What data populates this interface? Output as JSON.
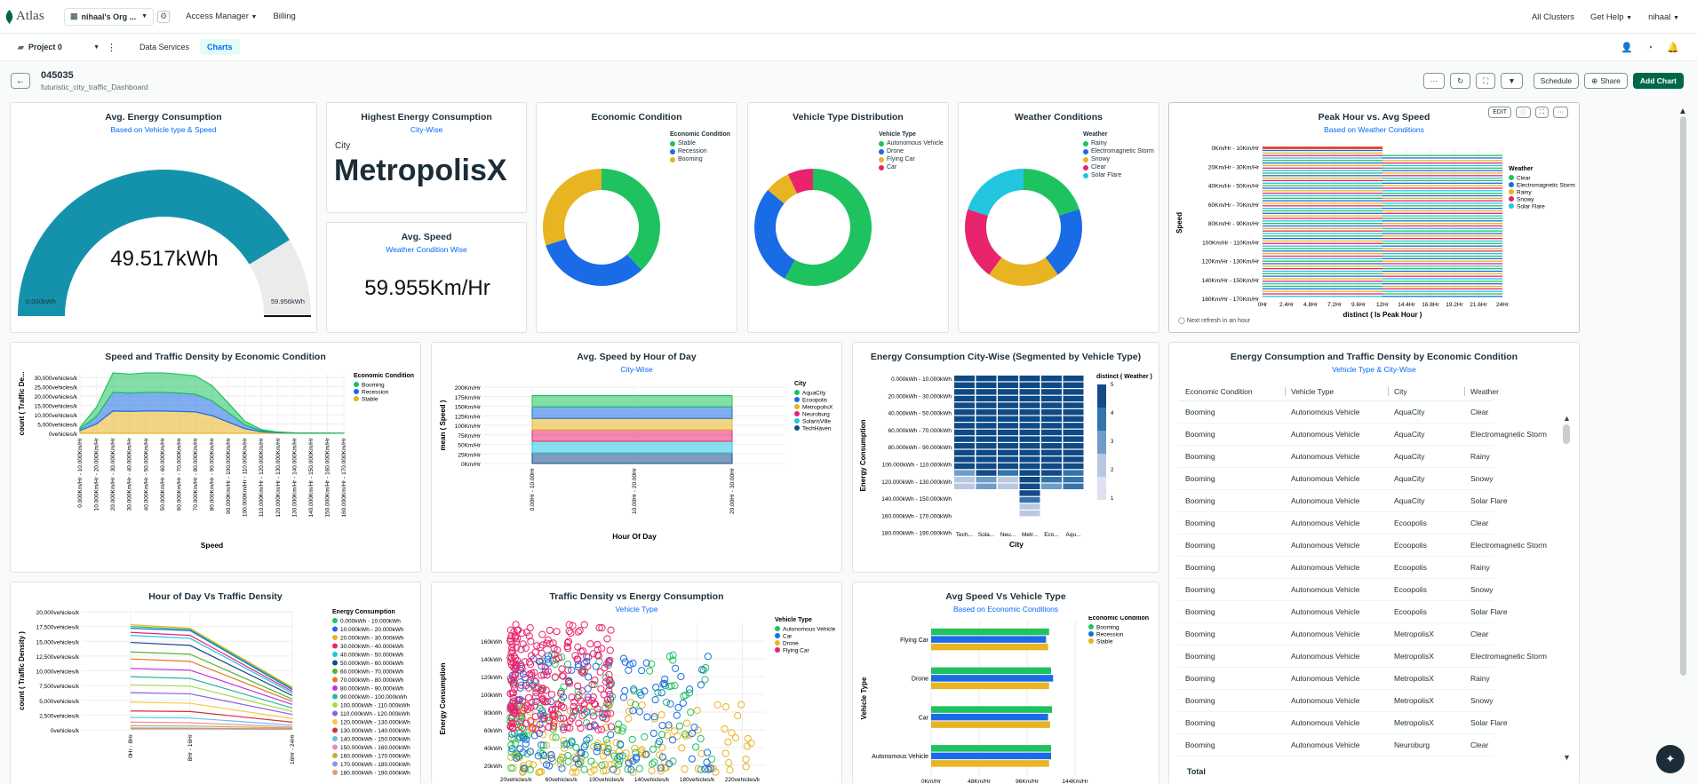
{
  "topbar": {
    "logo": "Atlas",
    "org": "nihaal's Org ...",
    "access": "Access Manager",
    "billing": "Billing",
    "all_clusters": "All Clusters",
    "get_help": "Get Help",
    "user": "nihaal"
  },
  "subbar": {
    "project": "Project 0",
    "tabs": [
      "Data Services",
      "Charts"
    ]
  },
  "dashboard": {
    "title": "045035",
    "subtitle": "futuristic_city_traffic_Dashboard",
    "schedule": "Schedule",
    "share": "Share",
    "add_chart": "Add Chart"
  },
  "colors": {
    "teal": "#1592ab",
    "green": "#1ec35f",
    "blue": "#1a6be6",
    "gold": "#e8b422",
    "pink": "#e8246d",
    "red": "#db3030",
    "cyan": "#22c6e0",
    "navy": "#164a87"
  },
  "cards": {
    "gauge": {
      "title": "Avg. Energy Consumption",
      "subtitle": "Based on Vehicle type & Speed",
      "value": "49.517kWh",
      "min": "0.000kWh",
      "max": "59.956kWh",
      "fraction": 0.826
    },
    "highest": {
      "title": "Highest Energy Consumption",
      "subtitle": "City-Wise",
      "label": "City",
      "value": "MetropolisX"
    },
    "avgspeed": {
      "title": "Avg. Speed",
      "subtitle": "Weather Condition Wise",
      "value": "59.955Km/Hr"
    },
    "economic": {
      "title": "Economic Condition",
      "legend_title": "Economic Condition"
    },
    "vehicle": {
      "title": "Vehicle Type Distribution",
      "legend_title": "Vehicle Type"
    },
    "weather": {
      "title": "Weather Conditions",
      "legend_title": "Weather"
    },
    "peak": {
      "title": "Peak Hour vs. Avg Speed",
      "subtitle": "Based on Weather Conditions",
      "xlabel": "distinct ( Is Peak Hour )",
      "ylabel": "Speed",
      "legend_title": "Weather",
      "edit": "EDIT",
      "refresh": "Next refresh in an hour"
    },
    "speedtraffic": {
      "title": "Speed and Traffic Density by Economic Condition",
      "xlabel": "Speed",
      "ylabel": "count ( Traffic De...",
      "legend_title": "Economic Condition"
    },
    "avgspeedhour": {
      "title": "Avg. Speed by Hour of Day",
      "subtitle": "City-Wise",
      "xlabel": "Hour Of Day",
      "ylabel": "mean ( Speed )",
      "legend_title": "City"
    },
    "energycity": {
      "title": "Energy Consumption City-Wise (Segmented by Vehicle Type)",
      "xlabel": "City",
      "ylabel": "Energy Consumption",
      "legend_title": "distinct ( Weather )"
    },
    "table": {
      "title": "Energy Consumption and Traffic Density by Economic Condition",
      "subtitle": "Vehicle Type & City-Wise",
      "headers": [
        "Economic Condition",
        "Vehicle Type",
        "City",
        "Weather"
      ],
      "total": "Total",
      "rows": [
        [
          "Booming",
          "Autonomous Vehicle",
          "AquaCity",
          "Clear"
        ],
        [
          "Booming",
          "Autonomous Vehicle",
          "AquaCity",
          "Electromagnetic Storm"
        ],
        [
          "Booming",
          "Autonomous Vehicle",
          "AquaCity",
          "Rainy"
        ],
        [
          "Booming",
          "Autonomous Vehicle",
          "AquaCity",
          "Snowy"
        ],
        [
          "Booming",
          "Autonomous Vehicle",
          "AquaCity",
          "Solar Flare"
        ],
        [
          "Booming",
          "Autonomous Vehicle",
          "Ecoopolis",
          "Clear"
        ],
        [
          "Booming",
          "Autonomous Vehicle",
          "Ecoopolis",
          "Electromagnetic Storm"
        ],
        [
          "Booming",
          "Autonomous Vehicle",
          "Ecoopolis",
          "Rainy"
        ],
        [
          "Booming",
          "Autonomous Vehicle",
          "Ecoopolis",
          "Snowy"
        ],
        [
          "Booming",
          "Autonomous Vehicle",
          "Ecoopolis",
          "Solar Flare"
        ],
        [
          "Booming",
          "Autonomous Vehicle",
          "MetropolisX",
          "Clear"
        ],
        [
          "Booming",
          "Autonomous Vehicle",
          "MetropolisX",
          "Electromagnetic Storm"
        ],
        [
          "Booming",
          "Autonomous Vehicle",
          "MetropolisX",
          "Rainy"
        ],
        [
          "Booming",
          "Autonomous Vehicle",
          "MetropolisX",
          "Snowy"
        ],
        [
          "Booming",
          "Autonomous Vehicle",
          "MetropolisX",
          "Solar Flare"
        ],
        [
          "Booming",
          "Autonomous Vehicle",
          "Neuroburg",
          "Clear"
        ]
      ]
    },
    "hourtraffic": {
      "title": "Hour of Day Vs Traffic Density",
      "ylabel": "count ( Traffic Density )",
      "legend_title": "Energy Consumption"
    },
    "scatter": {
      "title": "Traffic Density vs Energy Consumption",
      "subtitle": "Vehicle Type",
      "ylabel": "Energy Consumption",
      "legend_title": "Vehicle Type"
    },
    "avgvehicle": {
      "title": "Avg Speed Vs Vehicle Type",
      "subtitle": "Based on Economic Conditions",
      "ylabel": "Vehicle Type",
      "legend_title": "Economic Condition"
    }
  },
  "chart_data": [
    {
      "type": "pie",
      "title": "Economic Condition",
      "legend": [
        "Stable",
        "Recession",
        "Booming"
      ],
      "values": [
        38,
        32,
        30
      ],
      "colors": [
        "#1ec35f",
        "#1a6be6",
        "#e8b422"
      ]
    },
    {
      "type": "pie",
      "title": "Vehicle Type Distribution",
      "legend": [
        "Autonomous Vehicle",
        "Drone",
        "Flying Car",
        "Car"
      ],
      "values": [
        58,
        28,
        7,
        7
      ],
      "colors": [
        "#1ec35f",
        "#1a6be6",
        "#e8b422",
        "#e8246d"
      ]
    },
    {
      "type": "pie",
      "title": "Weather Conditions",
      "legend": [
        "Rainy",
        "Electromagnetic Storm",
        "Snowy",
        "Clear",
        "Solar Flare"
      ],
      "values": [
        20,
        20,
        20,
        20,
        20
      ],
      "colors": [
        "#1ec35f",
        "#1a6be6",
        "#e8b422",
        "#e8246d",
        "#22c6e0"
      ]
    },
    {
      "type": "bar",
      "title": "Peak Hour vs. Avg Speed",
      "y_categories": [
        "0Km/Hr - 10Km/Hr",
        "20Km/Hr - 30Km/Hr",
        "40Km/Hr - 50Km/Hr",
        "60Km/Hr - 70Km/Hr",
        "80Km/Hr - 90Km/Hr",
        "100Km/Hr - 110Km/Hr",
        "120Km/Hr - 130Km/Hr",
        "140Km/Hr - 150Km/Hr",
        "160Km/Hr - 170Km/Hr"
      ],
      "x_ticks": [
        "0Hr",
        "2.4Hr",
        "4.8Hr",
        "7.2Hr",
        "9.6Hr",
        "12Hr",
        "14.4Hr",
        "16.8Hr",
        "19.2Hr",
        "21.6Hr",
        "24Hr"
      ],
      "legend": [
        "Clear",
        "Electromagnetic Storm",
        "Rainy",
        "Snowy",
        "Solar Flare"
      ],
      "colors": [
        "#1ec35f",
        "#1a6be6",
        "#e8b422",
        "#e8246d",
        "#22c6e0"
      ],
      "xlim": [
        0,
        24
      ]
    },
    {
      "type": "area",
      "title": "Speed and Traffic Density by Economic Condition",
      "categories": [
        "0.000Km/Hr - 10.000Km/Hr",
        "10.000Km/Hr - 20.000Km/Hr",
        "20.000Km/Hr - 30.000Km/Hr",
        "30.000Km/Hr - 40.000Km/Hr",
        "40.000Km/Hr - 50.000Km/Hr",
        "50.000Km/Hr - 60.000Km/Hr",
        "60.000Km/Hr - 70.000Km/Hr",
        "70.000Km/Hr - 80.000Km/Hr",
        "80.000Km/Hr - 90.000Km/Hr",
        "90.000Km/Hr - 100.000Km/Hr",
        "100.000Km/Hr - 110.000Km/Hr",
        "110.000Km/Hr - 120.000Km/Hr",
        "120.000Km/Hr - 130.000Km/Hr",
        "130.000Km/Hr - 140.000Km/Hr",
        "140.000Km/Hr - 150.000Km/Hr",
        "150.000Km/Hr - 160.000Km/Hr",
        "160.000Km/Hr - 170.000Km/Hr"
      ],
      "y_ticks": [
        "0vehicles/k",
        "5,000vehicles/k",
        "10,000vehicles/k",
        "15,000vehicles/k",
        "20,000vehicles/k",
        "25,000vehicles/k",
        "30,000vehicles/k"
      ],
      "ylim": [
        0,
        32000
      ],
      "series": [
        {
          "name": "Stable",
          "color": "#e8b422",
          "values": [
            1500,
            5000,
            12000,
            11800,
            12000,
            12000,
            11800,
            11500,
            9500,
            6000,
            2500,
            800,
            300,
            100,
            50,
            30,
            20
          ]
        },
        {
          "name": "Recession",
          "color": "#1a6be6",
          "values": [
            800,
            4000,
            10000,
            9800,
            10000,
            10000,
            9800,
            9500,
            8000,
            5000,
            2000,
            600,
            200,
            80,
            40,
            20,
            10
          ]
        },
        {
          "name": "Booming",
          "color": "#1ec35f",
          "values": [
            800,
            5000,
            10500,
            10200,
            10500,
            10500,
            10200,
            9900,
            8200,
            5200,
            2000,
            600,
            200,
            80,
            40,
            20,
            10
          ]
        }
      ]
    },
    {
      "type": "area",
      "title": "Avg. Speed by Hour of Day",
      "categories": [
        "0.00Hr - 10.00Hr",
        "10.00Hr - 20.00Hr",
        "20.00Hr - 30.00Hr"
      ],
      "y_ticks": [
        "0Km/Hr",
        "25Km/Hr",
        "50Km/Hr",
        "75Km/Hr",
        "100Km/Hr",
        "125Km/Hr",
        "150Km/Hr",
        "175Km/Hr",
        "200Km/Hr"
      ],
      "ylim": [
        0,
        200
      ],
      "legend": [
        "AquaCity",
        "Ecoopolis",
        "MetropolisX",
        "Neuroburg",
        "SolarisVille",
        "TechHaven"
      ],
      "series": [
        {
          "name": "TechHaven",
          "color": "#164a87",
          "values": [
            28,
            28,
            28
          ]
        },
        {
          "name": "SolarisVille",
          "color": "#22c6e0",
          "values": [
            30,
            30,
            30
          ]
        },
        {
          "name": "Neuroburg",
          "color": "#e8246d",
          "values": [
            30,
            30,
            30
          ]
        },
        {
          "name": "MetropolisX",
          "color": "#e8b422",
          "values": [
            30,
            30,
            30
          ]
        },
        {
          "name": "Ecoopolis",
          "color": "#1a6be6",
          "values": [
            30,
            30,
            30
          ]
        },
        {
          "name": "AquaCity",
          "color": "#1ec35f",
          "values": [
            30,
            30,
            30
          ]
        }
      ]
    },
    {
      "type": "heatmap",
      "title": "Energy Consumption City-Wise (Segmented by Vehicle Type)",
      "x_categories": [
        "Tech...",
        "Sola...",
        "Neu...",
        "Metr...",
        "Eco...",
        "Aqu..."
      ],
      "y_categories": [
        "0.000kWh - 10.000kWh",
        "20.000kWh - 30.000kWh",
        "40.000kWh - 50.000kWh",
        "60.000kWh - 70.000kWh",
        "80.000kWh - 90.000kWh",
        "100.000kWh - 110.000kWh",
        "120.000kWh - 130.000kWh",
        "140.000kWh - 150.000kWh",
        "160.000kWh - 170.000kWh",
        "180.000kWh - 190.000kWh"
      ],
      "scale_ticks": [
        "1",
        "2",
        "3",
        "4",
        "5"
      ],
      "column_values": [
        [
          5,
          5,
          5,
          5,
          5,
          5,
          5,
          5,
          5,
          5,
          5,
          5,
          5,
          5,
          2,
          1,
          1,
          0,
          0,
          0,
          0
        ],
        [
          5,
          5,
          5,
          5,
          5,
          5,
          5,
          5,
          5,
          5,
          5,
          5,
          5,
          5,
          4,
          2,
          2,
          0,
          0,
          0,
          0
        ],
        [
          5,
          5,
          5,
          5,
          5,
          5,
          5,
          5,
          5,
          5,
          5,
          5,
          5,
          5,
          3,
          1,
          1,
          0,
          0,
          0,
          0
        ],
        [
          5,
          5,
          5,
          5,
          5,
          5,
          5,
          5,
          5,
          5,
          5,
          5,
          5,
          5,
          5,
          5,
          4,
          4,
          3,
          1,
          1
        ],
        [
          5,
          5,
          5,
          5,
          5,
          5,
          5,
          5,
          5,
          5,
          5,
          5,
          5,
          5,
          4,
          3,
          2,
          0,
          0,
          0,
          0
        ],
        [
          5,
          5,
          5,
          5,
          5,
          5,
          5,
          5,
          5,
          5,
          5,
          5,
          5,
          4,
          3,
          3,
          3,
          0,
          0,
          0,
          0
        ]
      ]
    },
    {
      "type": "line",
      "title": "Hour of Day Vs Traffic Density",
      "categories": [
        "0Hr - 8Hr",
        "8Hr - 16Hr",
        "16Hr - 24Hr"
      ],
      "y_ticks": [
        "0vehicles/k",
        "2,500vehicles/k",
        "5,000vehicles/k",
        "7,500vehicles/k",
        "10,000vehicles/k",
        "12,500vehicles/k",
        "15,000vehicles/k",
        "17,500vehicles/k",
        "20,000vehicles/k"
      ],
      "ylim": [
        0,
        20000
      ],
      "series": [
        {
          "name": "0.000kWh - 10.000kWh",
          "color": "#1ec35f",
          "values": [
            17500,
            17000,
            7000
          ]
        },
        {
          "name": "10.000kWh - 20.000kWh",
          "color": "#1a6be6",
          "values": [
            17200,
            16800,
            6800
          ]
        },
        {
          "name": "20.000kWh - 30.000kWh",
          "color": "#e8b422",
          "values": [
            17800,
            17200,
            7200
          ]
        },
        {
          "name": "30.000kWh - 40.000kWh",
          "color": "#e8246d",
          "values": [
            16500,
            16000,
            6500
          ]
        },
        {
          "name": "40.000kWh - 50.000kWh",
          "color": "#22c6e0",
          "values": [
            16000,
            15500,
            6200
          ]
        },
        {
          "name": "50.000kWh - 60.000kWh",
          "color": "#164a87",
          "values": [
            14800,
            14300,
            5800
          ]
        },
        {
          "name": "60.000kWh - 70.000kWh",
          "color": "#52b52f",
          "values": [
            13200,
            12800,
            5200
          ]
        },
        {
          "name": "70.000kWh - 80.000kWh",
          "color": "#e87522",
          "values": [
            12000,
            11600,
            4800
          ]
        },
        {
          "name": "80.000kWh - 90.000kWh",
          "color": "#c333e8",
          "values": [
            10400,
            10100,
            4300
          ]
        },
        {
          "name": "90.000kWh - 100.000kWh",
          "color": "#2cb8a0",
          "values": [
            9000,
            8700,
            3700
          ]
        },
        {
          "name": "100.000kWh - 110.000kWh",
          "color": "#a3d94a",
          "values": [
            7600,
            7400,
            3100
          ]
        },
        {
          "name": "110.000kWh - 120.000kWh",
          "color": "#8a5ce8",
          "values": [
            6300,
            6100,
            2600
          ]
        },
        {
          "name": "120.000kWh - 130.000kWh",
          "color": "#f5c94a",
          "values": [
            4700,
            4500,
            1900
          ]
        },
        {
          "name": "130.000kWh - 140.000kWh",
          "color": "#db3030",
          "values": [
            3200,
            3100,
            1300
          ]
        },
        {
          "name": "140.000kWh - 150.000kWh",
          "color": "#5fc4e8",
          "values": [
            2100,
            2000,
            800
          ]
        },
        {
          "name": "150.000kWh - 160.000kWh",
          "color": "#f08ab0",
          "values": [
            1300,
            1200,
            500
          ]
        },
        {
          "name": "160.000kWh - 170.000kWh",
          "color": "#c1b03a",
          "values": [
            700,
            650,
            300
          ]
        },
        {
          "name": "170.000kWh - 180.000kWh",
          "color": "#7a9be8",
          "values": [
            300,
            280,
            150
          ]
        },
        {
          "name": "180.000kWh - 190.000kWh",
          "color": "#e89a6a",
          "values": [
            150,
            140,
            80
          ]
        }
      ]
    },
    {
      "type": "scatter",
      "title": "Traffic Density vs Energy Consumption",
      "x_ticks": [
        "20vehicles/k",
        "60vehicles/k",
        "100vehicles/k",
        "140vehicles/k",
        "180vehicles/k",
        "220vehicles/k"
      ],
      "y_ticks": [
        "20kWh",
        "40kWh",
        "60kWh",
        "80kWh",
        "100kWh",
        "120kWh",
        "140kWh",
        "160kWh"
      ],
      "xlim": [
        10,
        240
      ],
      "ylim": [
        10,
        180
      ],
      "series": [
        {
          "name": "Autonomous Vehicle",
          "color": "#1ec35f"
        },
        {
          "name": "Car",
          "color": "#1a6be6"
        },
        {
          "name": "Drone",
          "color": "#e8b422"
        },
        {
          "name": "Flying Car",
          "color": "#e8246d"
        }
      ]
    },
    {
      "type": "bar",
      "title": "Avg Speed Vs Vehicle Type",
      "categories": [
        "Flying Car",
        "Drone",
        "Car",
        "Autonomous Vehicle"
      ],
      "x_ticks": [
        "0Km/Hr",
        "48Km/Hr",
        "96Km/Hr",
        "144Km/Hr"
      ],
      "xlim": [
        0,
        144
      ],
      "series": [
        {
          "name": "Booming",
          "color": "#1ec35f",
          "values": [
            118,
            120,
            121,
            120
          ]
        },
        {
          "name": "Recession",
          "color": "#1a6be6",
          "values": [
            115,
            122,
            117,
            120
          ]
        },
        {
          "name": "Stable",
          "color": "#e8b422",
          "values": [
            117,
            118,
            119,
            118
          ]
        }
      ]
    }
  ]
}
